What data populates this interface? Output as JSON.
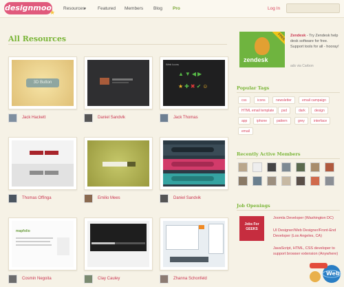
{
  "header": {
    "logo_text": "designmoo",
    "nav": [
      "Resources",
      "Featured",
      "Members",
      "Blog",
      "Pro"
    ],
    "login": "Log In"
  },
  "main": {
    "section_title": "All Resources",
    "resources": [
      {
        "author": "Jack Hackett",
        "thumb_label": "3D Button"
      },
      {
        "author": "Daniel Sandvik"
      },
      {
        "author": "Jack Thomas",
        "thumb_label": "Web Icons"
      },
      {
        "author": "Thomas Offinga"
      },
      {
        "author": "Emilio Mees"
      },
      {
        "author": "Daniel Sandvik"
      },
      {
        "author": "Cosmin Negoita",
        "thumb_label": "mapfolio"
      },
      {
        "author": "Clay Cauley"
      },
      {
        "author": "Zhanna Schonfeld"
      }
    ]
  },
  "sidebar": {
    "ad": {
      "brand": "zendesk",
      "ribbon": "FREE",
      "headline": "Zendesk",
      "body": " - Try Zendesk help desk software for free. Support tools for all - hooray!",
      "via": "ads via Carbon"
    },
    "popular_tags_title": "Popular Tags",
    "tags": [
      "css",
      "icons",
      "newsletter",
      "email campaign",
      "HTML email template",
      "psd",
      "dark",
      "design",
      "app",
      "iphone",
      "pattern",
      "grey",
      "interface",
      "email"
    ],
    "members_title": "Recently Active Members",
    "job_title": "Job Openings",
    "jobs_logo": "Jobs For GEEKS",
    "jobs": [
      "Joomla Developer (Washington DC)",
      "UI Designer/Web Designer/Front-End Developer (Los Angeles, CA)",
      "JavaScript, HTML, CSS developer to support browser extension (Anywhere)"
    ],
    "badge": "Web"
  },
  "colors": {
    "accent_green": "#7ab537",
    "link_red": "#c9334e",
    "background": "#f6f2e6"
  }
}
